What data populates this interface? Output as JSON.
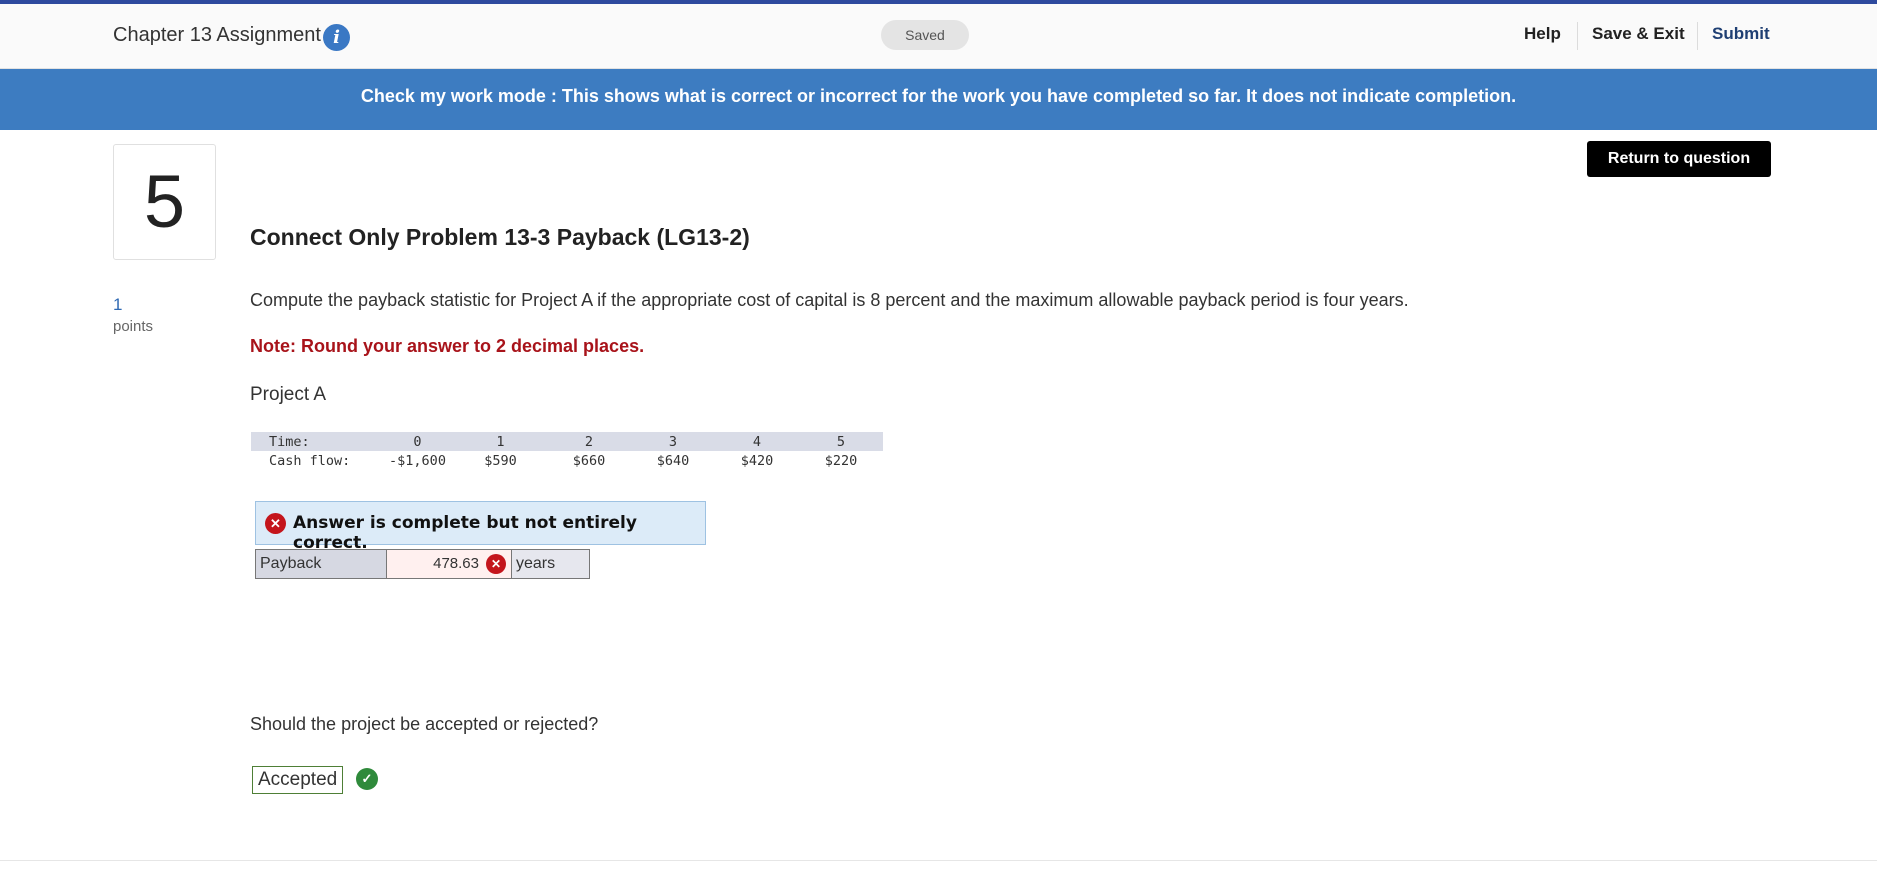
{
  "header": {
    "title": "Chapter 13 Assignment",
    "status": "Saved",
    "help_label": "Help",
    "save_exit_label": "Save & Exit",
    "submit_label": "Submit"
  },
  "banner": {
    "text": "Check my work mode : This shows what is correct or incorrect for the work you have completed so far. It does not indicate completion."
  },
  "question": {
    "number": "5",
    "return_label": "Return to question",
    "title": "Connect Only Problem 13-3 Payback (LG13-2)",
    "points_value": "1",
    "points_label": "points",
    "text": "Compute the payback statistic for Project A if the appropriate cost of capital is 8 percent and the maximum allowable payback period is four years.",
    "note": "Note: Round your answer to 2 decimal places.",
    "project_label": "Project A"
  },
  "cash_flow_table": {
    "time_label": "Time:",
    "cash_label": "Cash flow:",
    "times": [
      "0",
      "1",
      "2",
      "3",
      "4",
      "5"
    ],
    "cash_flows": [
      "-$1,600",
      "$590",
      "$660",
      "$640",
      "$420",
      "$220"
    ]
  },
  "answer": {
    "status_text": "Answer is complete but not entirely correct.",
    "payback_label": "Payback",
    "payback_value": "478.63",
    "payback_unit": "years"
  },
  "question2": {
    "text": "Should the project be accepted or rejected?",
    "answer": "Accepted"
  },
  "colors": {
    "banner": "#3d7cc1",
    "incorrect": "#c4151c",
    "correct": "#2f8a3b",
    "note": "#a8131a"
  }
}
